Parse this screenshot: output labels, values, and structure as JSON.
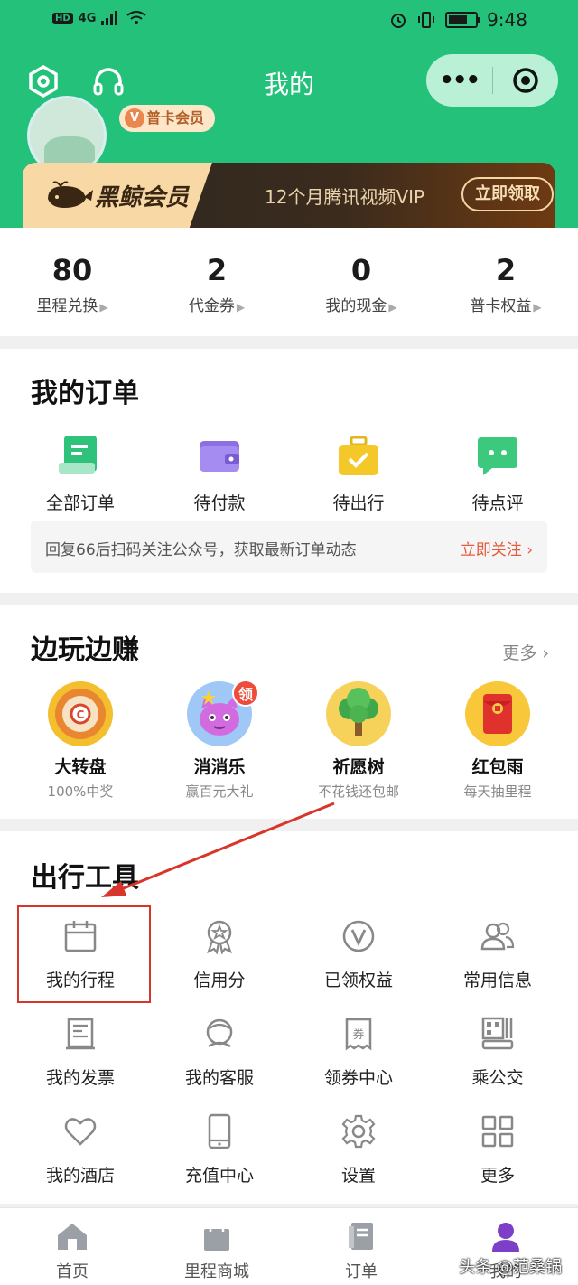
{
  "status_bar": {
    "network": "4G",
    "time": "9:48",
    "hd": "HD",
    "battery_level": 0.7
  },
  "header": {
    "title": "我的"
  },
  "member": {
    "tag": "普卡会员",
    "tag_badge": "V"
  },
  "banner": {
    "brand": "黑鲸会员",
    "text": "12个月腾讯视频VIP",
    "button": "立即领取"
  },
  "stats": [
    {
      "value": "80",
      "label": "里程兑换"
    },
    {
      "value": "2",
      "label": "代金券"
    },
    {
      "value": "0",
      "label": "我的现金"
    },
    {
      "value": "2",
      "label": "普卡权益"
    }
  ],
  "orders": {
    "title": "我的订单",
    "items": [
      {
        "label": "全部订单",
        "icon": "order-list-icon"
      },
      {
        "label": "待付款",
        "icon": "wallet-icon"
      },
      {
        "label": "待出行",
        "icon": "suitcase-icon"
      },
      {
        "label": "待点评",
        "icon": "comment-icon"
      }
    ],
    "notice": "回复66后扫码关注公众号，获取最新订单动态",
    "notice_link": "立即关注 ›"
  },
  "earn": {
    "title": "边玩边赚",
    "more": "更多 ›",
    "badge": "领",
    "items": [
      {
        "title": "大转盘",
        "sub": "100%中奖",
        "icon": "wheel-icon"
      },
      {
        "title": "消消乐",
        "sub": "赢百元大礼",
        "icon": "game-icon"
      },
      {
        "title": "祈愿树",
        "sub": "不花钱还包邮",
        "icon": "tree-icon"
      },
      {
        "title": "红包雨",
        "sub": "每天抽里程",
        "icon": "red-envelope-icon"
      }
    ]
  },
  "tools": {
    "title": "出行工具",
    "items": [
      {
        "label": "我的行程",
        "icon": "calendar-icon"
      },
      {
        "label": "信用分",
        "icon": "medal-icon"
      },
      {
        "label": "已领权益",
        "icon": "vip-icon"
      },
      {
        "label": "常用信息",
        "icon": "contacts-icon"
      },
      {
        "label": "我的发票",
        "icon": "invoice-icon"
      },
      {
        "label": "我的客服",
        "icon": "service-icon"
      },
      {
        "label": "领券中心",
        "icon": "coupon-icon"
      },
      {
        "label": "乘公交",
        "icon": "bus-icon"
      },
      {
        "label": "我的酒店",
        "icon": "heart-icon"
      },
      {
        "label": "充值中心",
        "icon": "phone-icon"
      },
      {
        "label": "设置",
        "icon": "gear-icon"
      },
      {
        "label": "更多",
        "icon": "grid-icon"
      }
    ]
  },
  "tabbar": [
    {
      "label": "首页",
      "icon": "home-icon"
    },
    {
      "label": "里程商城",
      "icon": "shopping-bag-icon"
    },
    {
      "label": "订单",
      "icon": "orders-tab-icon"
    },
    {
      "label": "我的",
      "icon": "profile-icon"
    }
  ],
  "watermark": "头条 @范桑锅",
  "colors": {
    "brand_green": "#23c179",
    "accent_red": "#e65a3c",
    "highlight_red": "#d9362b"
  }
}
